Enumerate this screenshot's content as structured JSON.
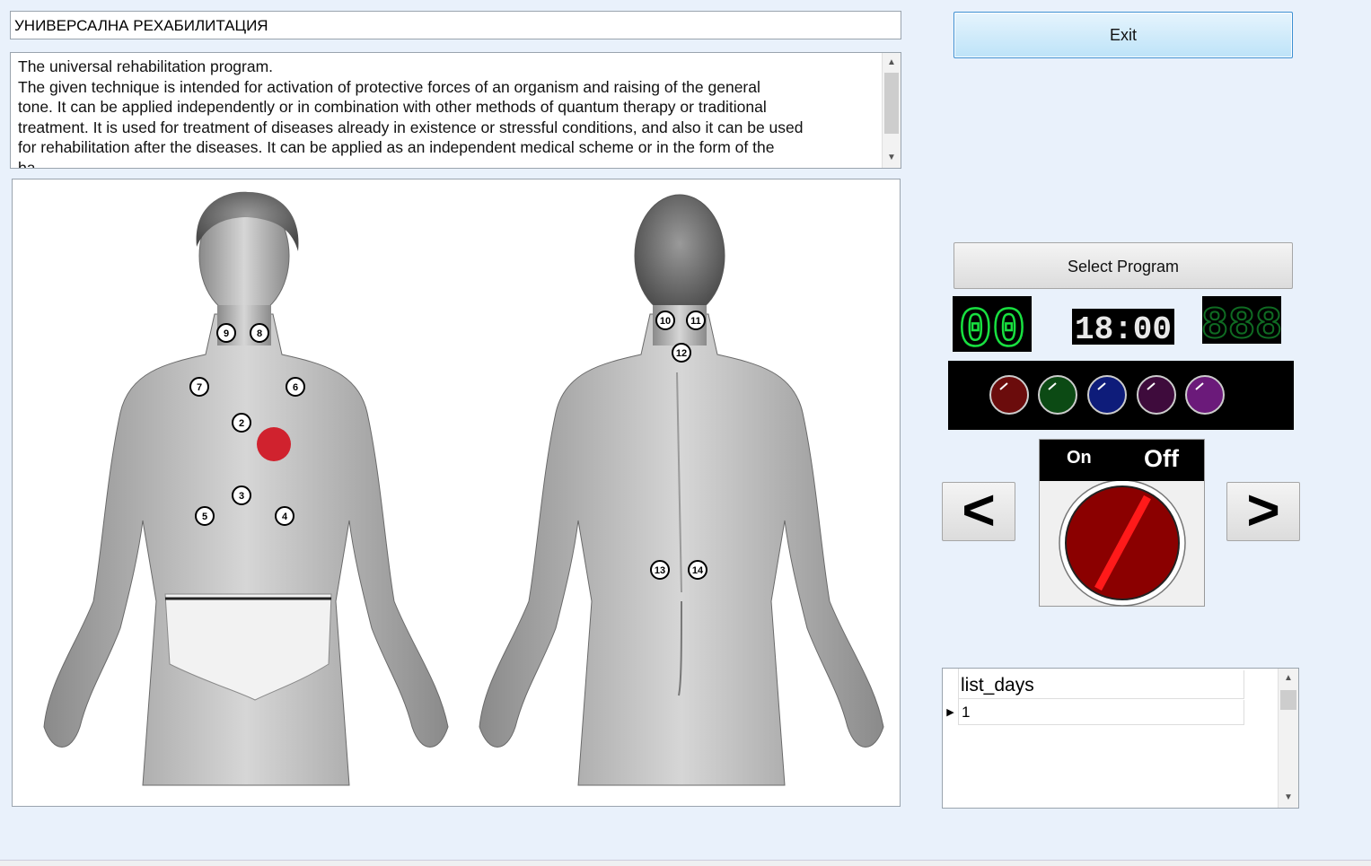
{
  "window": {
    "title_value": "УНИВЕРСАЛНА РЕХАБИЛИТАЦИЯ"
  },
  "description": {
    "text": "The universal rehabilitation program.\nThe given technique is intended for activation of protective forces of an organism and raising of the general\ntone. It can be applied independently or in combination with other methods of quantum therapy or traditional\ntreatment. It is used for treatment of diseases already in existence or stressful conditions, and also it can be used\nfor rehabilitation after the diseases. It can be applied as an independent medical scheme or in the form of the\nba"
  },
  "body_map": {
    "front_points": [
      "9",
      "8",
      "7",
      "6",
      "2",
      "3",
      "5",
      "4"
    ],
    "back_points": [
      "10",
      "11",
      "12",
      "13",
      "14"
    ],
    "active_marker_color": "#d0222e"
  },
  "buttons": {
    "exit_label": "Exit",
    "select_program_label": "Select Program",
    "prev_label": "<",
    "next_label": ">"
  },
  "displays": {
    "left_lcd": "00",
    "timer": "18:00",
    "right_lcd": "888",
    "lcd_color": "#18e040",
    "timer_color": "#e8e8e8"
  },
  "color_buttons": [
    {
      "name": "red",
      "color": "#6b0c0c"
    },
    {
      "name": "green",
      "color": "#0c4a14"
    },
    {
      "name": "blue",
      "color": "#0e1c7a"
    },
    {
      "name": "dark-purple",
      "color": "#3e0b3c"
    },
    {
      "name": "purple",
      "color": "#6b1a7a"
    }
  ],
  "power_switch": {
    "on_label": "On",
    "off_label": "Off",
    "state": "Off",
    "knob_color": "#8b0000",
    "indicator_color": "#ff1a1a"
  },
  "days_grid": {
    "column_header": "list_days",
    "rows": [
      "1"
    ]
  }
}
